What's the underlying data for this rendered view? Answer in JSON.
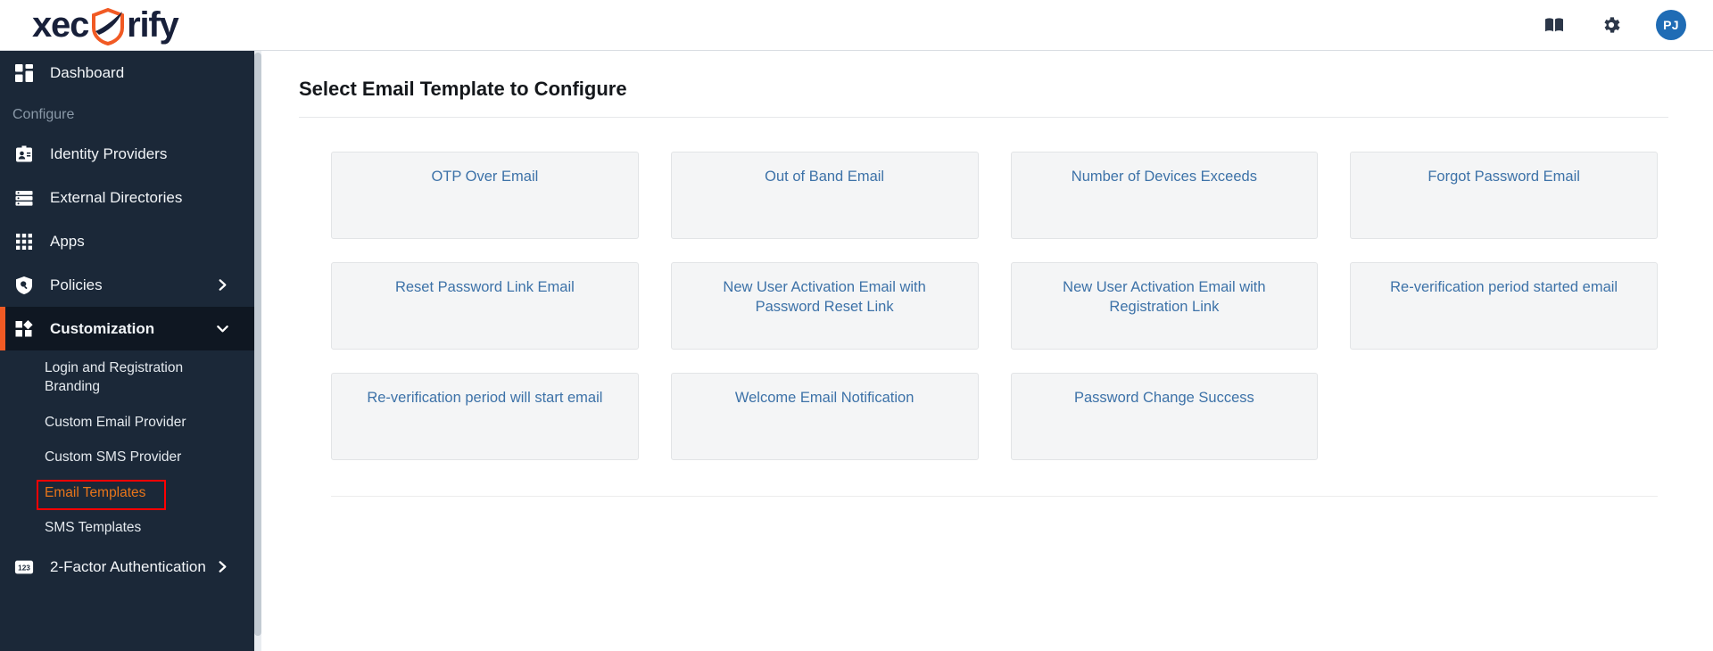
{
  "header": {
    "logo_text_before": "xec",
    "logo_text_after": "rify",
    "logo_icon": "shield-check-icon",
    "book_icon": "book-icon",
    "gear_icon": "gear-icon",
    "avatar_initials": "PJ",
    "avatar_color": "#1f6cb5"
  },
  "sidebar": {
    "accent_color": "#f15a24",
    "background": "#1b2838",
    "dashboard": {
      "label": "Dashboard",
      "icon": "dashboard-grid-icon"
    },
    "section_label": "Configure",
    "items": [
      {
        "label": "Identity Providers",
        "icon": "id-card-icon",
        "chevron": ""
      },
      {
        "label": "External Directories",
        "icon": "directory-list-icon",
        "chevron": ""
      },
      {
        "label": "Apps",
        "icon": "apps-grid-icon",
        "chevron": ""
      },
      {
        "label": "Policies",
        "icon": "shield-search-icon",
        "chevron": "right"
      },
      {
        "label": "Customization",
        "icon": "customization-blocks-icon",
        "chevron": "down",
        "active": true
      }
    ],
    "customization_subitems": [
      {
        "label": "Login and Registration Branding",
        "highlighted": false
      },
      {
        "label": "Custom Email Provider",
        "highlighted": false
      },
      {
        "label": "Custom SMS Provider",
        "highlighted": false
      },
      {
        "label": "Email Templates",
        "highlighted": true
      },
      {
        "label": "SMS Templates",
        "highlighted": false
      }
    ],
    "footer_item": {
      "label": "2-Factor Authentication",
      "icon": "numeric-123-icon",
      "chevron": "right"
    }
  },
  "main": {
    "title": "Select Email Template to Configure",
    "cards": [
      {
        "label": "OTP Over Email"
      },
      {
        "label": "Out of Band Email"
      },
      {
        "label": "Number of Devices Exceeds"
      },
      {
        "label": "Forgot Password Email"
      },
      {
        "label": "Reset Password Link Email"
      },
      {
        "label": "New User Activation Email with Password Reset Link"
      },
      {
        "label": "New User Activation Email with Registration Link"
      },
      {
        "label": "Re-verification period started email"
      },
      {
        "label": "Re-verification period will start email"
      },
      {
        "label": "Welcome Email Notification"
      },
      {
        "label": "Password Change Success"
      }
    ]
  }
}
